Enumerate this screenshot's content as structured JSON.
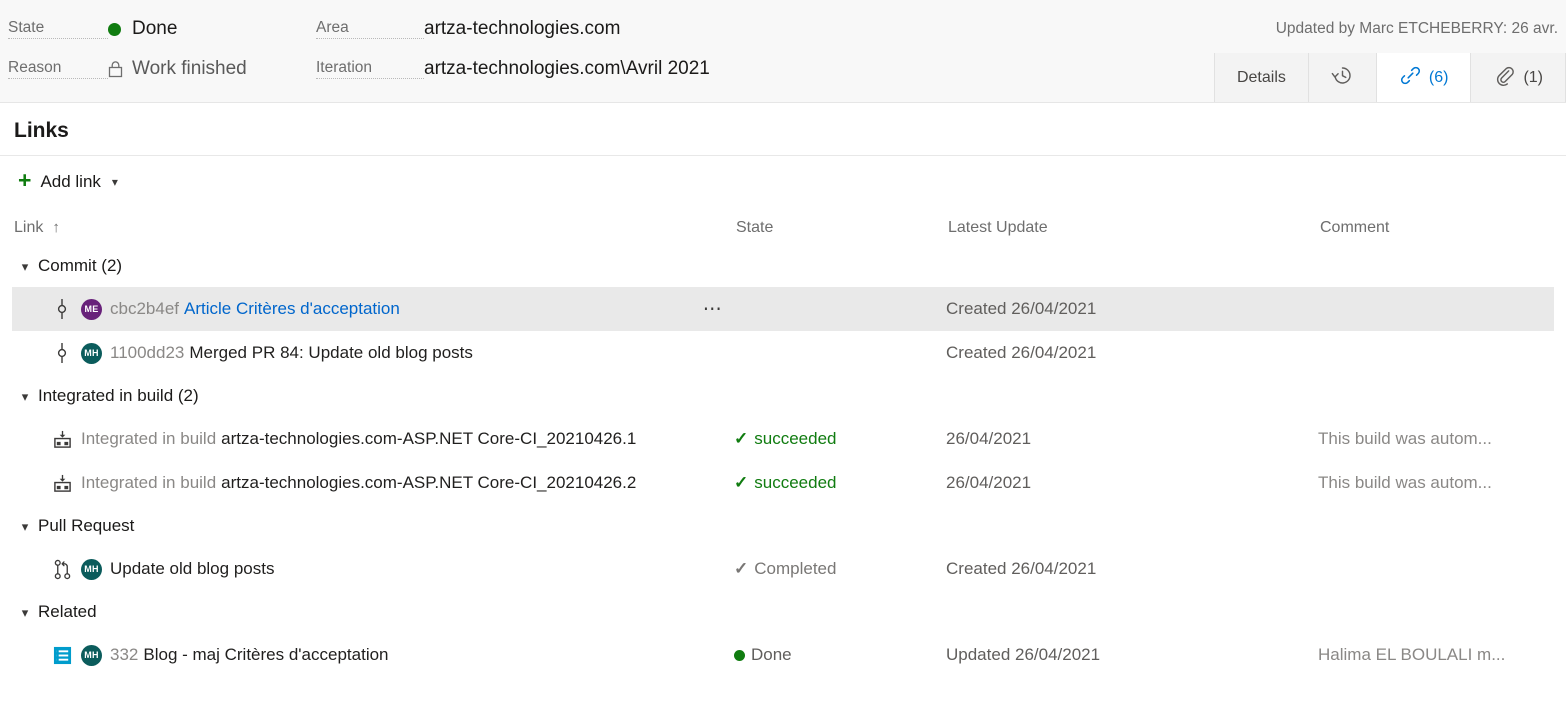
{
  "header": {
    "fields": [
      {
        "label": "State",
        "value": "Done",
        "icon": "green-dot"
      },
      {
        "label": "Reason",
        "value": "Work finished",
        "icon": "lock-icon"
      },
      {
        "label": "Area",
        "value": "artza-technologies.com"
      },
      {
        "label": "Iteration",
        "value": "artza-technologies.com\\Avril 2021"
      }
    ],
    "updated_by": "Updated by Marc ETCHEBERRY: 26 avr.",
    "tabs": [
      {
        "label": "Details",
        "icon": "",
        "count": "",
        "active": false
      },
      {
        "label": "",
        "icon": "history-icon",
        "count": "",
        "active": false
      },
      {
        "label": "",
        "icon": "link-icon",
        "count": "(6)",
        "active": true
      },
      {
        "label": "",
        "icon": "paperclip-icon",
        "count": "(1)",
        "active": false
      }
    ]
  },
  "page": {
    "title": "Links",
    "add_link_label": "Add link"
  },
  "grid": {
    "columns": [
      "Link",
      "State",
      "Latest Update",
      "Comment"
    ],
    "sort_indicator": "↑",
    "groups": [
      {
        "name": "Commit (2)",
        "expanded": true,
        "rows": [
          {
            "icon": "commit-icon",
            "avatar": {
              "initials": "ME",
              "color": "#68217a"
            },
            "id": "cbc2b4ef",
            "title": "Article Critères d'acceptation",
            "title_style": "link",
            "state": "",
            "state_style": "",
            "latest_update": "Created 26/04/2021",
            "comment": "",
            "hovered": true,
            "has_menu": true
          },
          {
            "icon": "commit-icon",
            "avatar": {
              "initials": "MH",
              "color": "#0b5c5c"
            },
            "id": "1100dd23",
            "title": "Merged PR 84: Update old blog posts",
            "title_style": "dark",
            "state": "",
            "state_style": "",
            "latest_update": "Created 26/04/2021",
            "comment": "",
            "hovered": false,
            "has_menu": false
          }
        ]
      },
      {
        "name": "Integrated in build (2)",
        "expanded": true,
        "rows": [
          {
            "icon": "build-icon",
            "avatar": null,
            "id": "Integrated in build",
            "title": "artza-technologies.com-ASP.NET Core-CI_20210426.1",
            "title_style": "dark",
            "state": "succeeded",
            "state_style": "succeeded",
            "latest_update": "26/04/2021",
            "comment": "This build was autom...",
            "hovered": false,
            "has_menu": false
          },
          {
            "icon": "build-icon",
            "avatar": null,
            "id": "Integrated in build",
            "title": "artza-technologies.com-ASP.NET Core-CI_20210426.2",
            "title_style": "dark",
            "state": "succeeded",
            "state_style": "succeeded",
            "latest_update": "26/04/2021",
            "comment": "This build was autom...",
            "hovered": false,
            "has_menu": false
          }
        ]
      },
      {
        "name": "Pull Request",
        "expanded": true,
        "rows": [
          {
            "icon": "pull-request-icon",
            "avatar": {
              "initials": "MH",
              "color": "#0b5c5c"
            },
            "id": "",
            "title": "Update old blog posts",
            "title_style": "dark",
            "state": "Completed",
            "state_style": "completed",
            "latest_update": "Created 26/04/2021",
            "comment": "",
            "hovered": false,
            "has_menu": false
          }
        ]
      },
      {
        "name": "Related",
        "expanded": true,
        "rows": [
          {
            "icon": "backlog-item-icon",
            "avatar": {
              "initials": "MH",
              "color": "#0b5c5c"
            },
            "id": "332",
            "title": "Blog - maj Critères d'acceptation",
            "title_style": "dark",
            "state": "Done",
            "state_style": "done",
            "latest_update": "Updated 26/04/2021",
            "comment": "Halima EL BOULALI m...",
            "hovered": false,
            "has_menu": false
          }
        ]
      }
    ]
  },
  "colors": {
    "accent": "#0078d4",
    "link": "#0066cc",
    "success": "#107c10",
    "avatar_purple": "#68217a",
    "avatar_teal": "#0b5c5c",
    "backlog_icon": "#009ccc"
  }
}
